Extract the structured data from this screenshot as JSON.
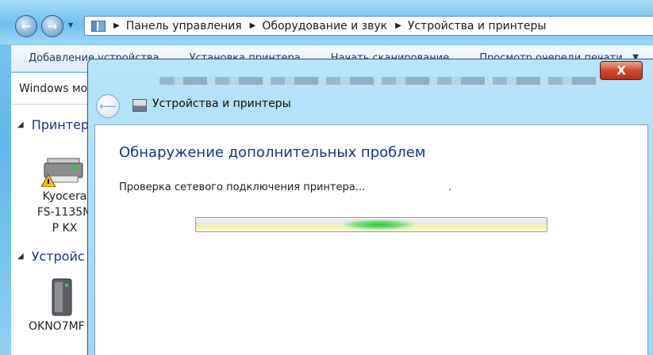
{
  "explorer": {
    "back_glyph": "←",
    "forward_glyph": "→",
    "history_glyph": "▼",
    "breadcrumb": [
      {
        "sep": "▶",
        "label": "Панель управления"
      },
      {
        "sep": "▶",
        "label": "Оборудование и звук"
      },
      {
        "sep": "▶",
        "label": "Устройства и принтеры"
      }
    ],
    "commands": [
      "Добавление устройства",
      "Установка принтера",
      "Начать сканирование",
      "Просмотр очереди печати"
    ],
    "command_overflow": "▼",
    "mobile_tab": "Windows мо",
    "group_printers": "Принтер",
    "group_devices": "Устройс",
    "group_arrow": "◢",
    "printer_label": "Kyocera\nFS-1135M\nP KX",
    "computer_label": "OKNO7MF"
  },
  "dialog": {
    "close_glyph": "X",
    "back_glyph": "⟵",
    "app_title": "Устройства и принтеры",
    "heading": "Обнаружение дополнительных проблем",
    "status": "Проверка сетевого подключения принтера...",
    "status_trailing": ".",
    "progress_glow": {
      "center": 0.52,
      "width": 0.2
    }
  },
  "colors": {
    "heading": "#1a3291",
    "progress_green": "#2ec83c",
    "close_red": "#cf4a2d",
    "sky": "#6cc1ee"
  },
  "icons": {
    "address_icon": "control-panel-icon",
    "printer_icon": "printer-warning-icon",
    "computer_icon": "computer-tower-icon",
    "dialog_icon": "devices-printers-icon"
  }
}
